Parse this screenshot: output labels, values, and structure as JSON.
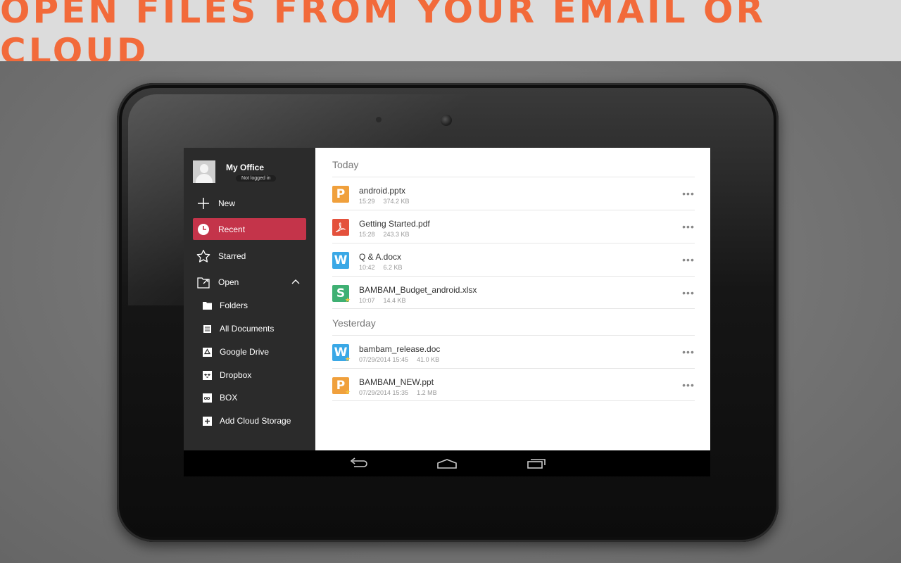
{
  "banner": {
    "title": "OPEN FILES FROM YOUR EMAIL OR CLOUD"
  },
  "colors": {
    "accent": "#f26a3a",
    "active_item": "#c4344a",
    "sidebar_bg": "#2b2b2b"
  },
  "profile": {
    "name": "My Office",
    "status": "Not logged in"
  },
  "sidebar": {
    "items": [
      {
        "label": "New",
        "icon": "plus-icon"
      },
      {
        "label": "Recent",
        "icon": "clock-icon",
        "active": true
      },
      {
        "label": "Starred",
        "icon": "star-icon"
      },
      {
        "label": "Open",
        "icon": "open-folder-icon",
        "expanded": true
      }
    ],
    "open_items": [
      {
        "label": "Folders",
        "icon": "folder-icon"
      },
      {
        "label": "All Documents",
        "icon": "documents-icon"
      },
      {
        "label": "Google Drive",
        "icon": "google-drive-icon"
      },
      {
        "label": "Dropbox",
        "icon": "dropbox-icon"
      },
      {
        "label": "BOX",
        "icon": "box-icon"
      },
      {
        "label": "Add Cloud Storage",
        "icon": "add-icon"
      }
    ]
  },
  "main": {
    "sections": [
      {
        "title": "Today",
        "files": [
          {
            "name": "android.pptx",
            "time": "15:29",
            "size": "374.2 KB",
            "type": "presentation",
            "icon_letter": "P",
            "color": "#f0a03c"
          },
          {
            "name": "Getting Started.pdf",
            "time": "15:28",
            "size": "243.3 KB",
            "type": "pdf",
            "icon_letter": "",
            "color": "#e4513c"
          },
          {
            "name": " Q & A.docx",
            "time": "10:42",
            "size": "6.2 KB",
            "type": "writer",
            "icon_letter": "W",
            "color": "#3aa8e6"
          },
          {
            "name": "BAMBAM_Budget_android.xlsx",
            "time": "10:07",
            "size": "14.4 KB",
            "type": "spreadsheet",
            "icon_letter": "S",
            "color": "#3fb073",
            "starred": true
          }
        ]
      },
      {
        "title": "Yesterday",
        "files": [
          {
            "name": "bambam_release.doc",
            "time": "07/29/2014 15:45",
            "size": "41.0 KB",
            "type": "writer",
            "icon_letter": "W",
            "color": "#3aa8e6",
            "starred": true
          },
          {
            "name": "BAMBAM_NEW.ppt",
            "time": "07/29/2014 15:35",
            "size": "1.2 MB",
            "type": "presentation",
            "icon_letter": "P",
            "color": "#f0a03c",
            "starred": true
          }
        ]
      }
    ]
  },
  "system_nav": {
    "buttons": [
      "back-icon",
      "home-icon",
      "recent-apps-icon"
    ]
  }
}
